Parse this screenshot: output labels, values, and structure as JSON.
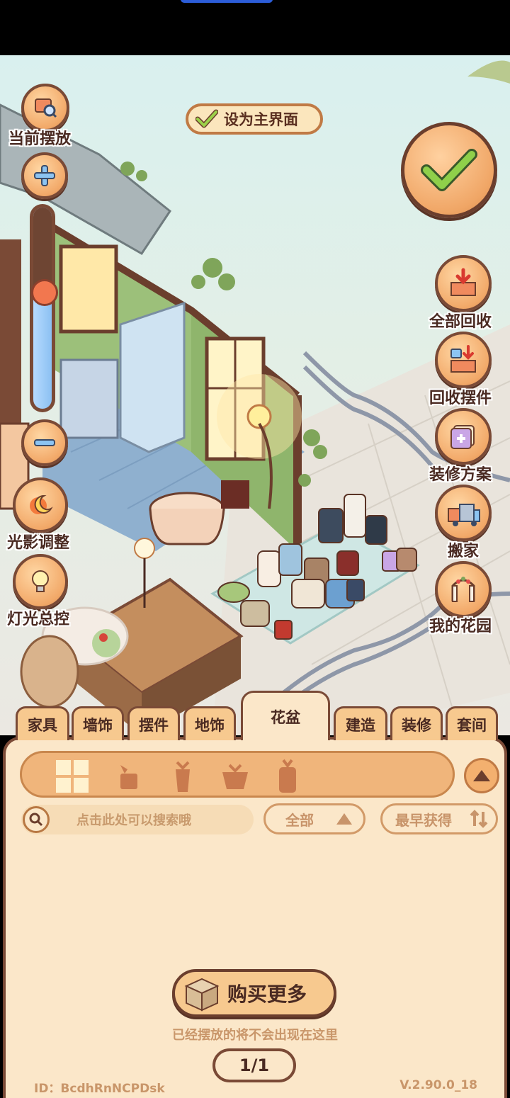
{
  "top_left_tools": {
    "current_placement": "当前摆放",
    "light_shadow": "光影调整",
    "light_master": "灯光总控"
  },
  "zoom": {
    "level": 0.4
  },
  "set_home": {
    "label": "设为主界面",
    "checked": true
  },
  "right_tools": {
    "recall_all": "全部回收",
    "recall_items": "回收摆件",
    "decor_plan": "装修方案",
    "move_house": "搬家",
    "my_garden": "我的花园"
  },
  "tabs": [
    "家具",
    "墙饰",
    "摆件",
    "地饰",
    "花盆",
    "建造",
    "装修",
    "套间"
  ],
  "active_tab": "花盆",
  "subcategories": [
    "all-grid-icon",
    "small-pot-icon",
    "tall-pot-icon",
    "wide-pot-icon",
    "hanging-pot-icon"
  ],
  "search": {
    "placeholder": "点击此处可以搜索哦"
  },
  "filter": {
    "label": "全部"
  },
  "sort": {
    "label": "最早获得"
  },
  "buy_more": {
    "label": "购买更多"
  },
  "hint": "已经摆放的将不会出现在这里",
  "pager": "1/1",
  "footer": {
    "id": "ID：BcdhRnNCPDsk",
    "version": "V.2.90.0_18"
  },
  "colors": {
    "accent": "#f2a969",
    "outline": "#7a4a36",
    "panel": "#fbe7c9"
  }
}
